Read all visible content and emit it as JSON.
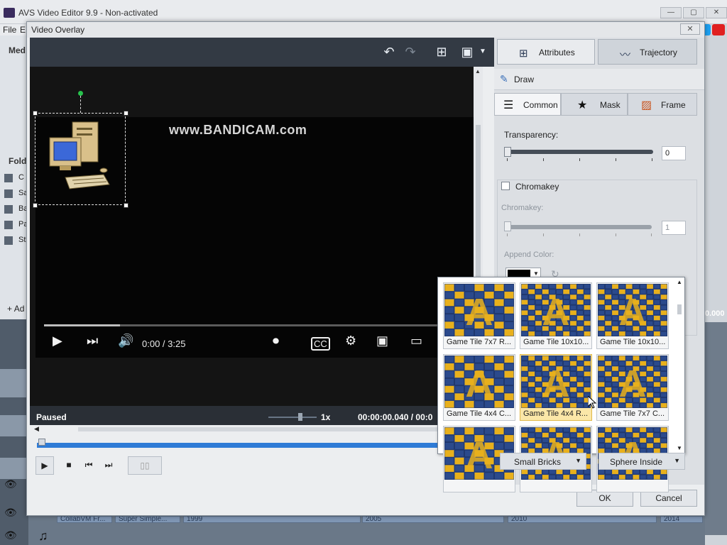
{
  "app": {
    "title": "AVS Video Editor 9.9 - Non-activated",
    "menu": [
      "File",
      "E"
    ],
    "left_labels": [
      "Med",
      "Fold"
    ],
    "folders": [
      "C",
      "Sa",
      "Ba",
      "Pa",
      "St"
    ],
    "add_label": "Ad",
    "right_value": "0.000",
    "timeline_clips": [
      "CollabVM Fr...",
      "Super Simple...",
      "1999",
      "2005",
      "2010",
      "2014"
    ]
  },
  "dialog": {
    "title": "Video Overlay",
    "close_label": "X"
  },
  "preview": {
    "watermark": "www.BANDICAM.com",
    "yt_time": "0:00 / 3:25",
    "yt_progress": 0.18,
    "status": "Paused",
    "speed": "1x",
    "timecode": "00:00:00.040 / 00:0"
  },
  "tabs": {
    "attributes": "Attributes",
    "trajectory": "Trajectory"
  },
  "section": {
    "title": "Draw"
  },
  "subtabs": {
    "common": "Common",
    "mask": "Mask",
    "frame": "Frame"
  },
  "transparency": {
    "label": "Transparency:",
    "value": "0"
  },
  "chromakey": {
    "checkbox_label": "Chromakey",
    "label": "Chromakey:",
    "value": "1",
    "append_color_label": "Append Color:"
  },
  "popup_tiles": [
    "Game Tile 7x7 R...",
    "Game Tile 10x10...",
    "Game Tile 10x10...",
    "Game Tile 4x4 C...",
    "Game Tile 4x4 R...",
    "Game Tile 7x7 C...",
    "",
    "",
    ""
  ],
  "combos": {
    "left": "Small Bricks",
    "right": "Sphere Inside"
  },
  "buttons": {
    "ok": "OK",
    "cancel": "Cancel"
  },
  "colors": {
    "accent": "#2f7bd6",
    "tile_blue": "#2b4a8c",
    "tile_gold": "#e8b01c",
    "panel_dark": "#333a44"
  }
}
